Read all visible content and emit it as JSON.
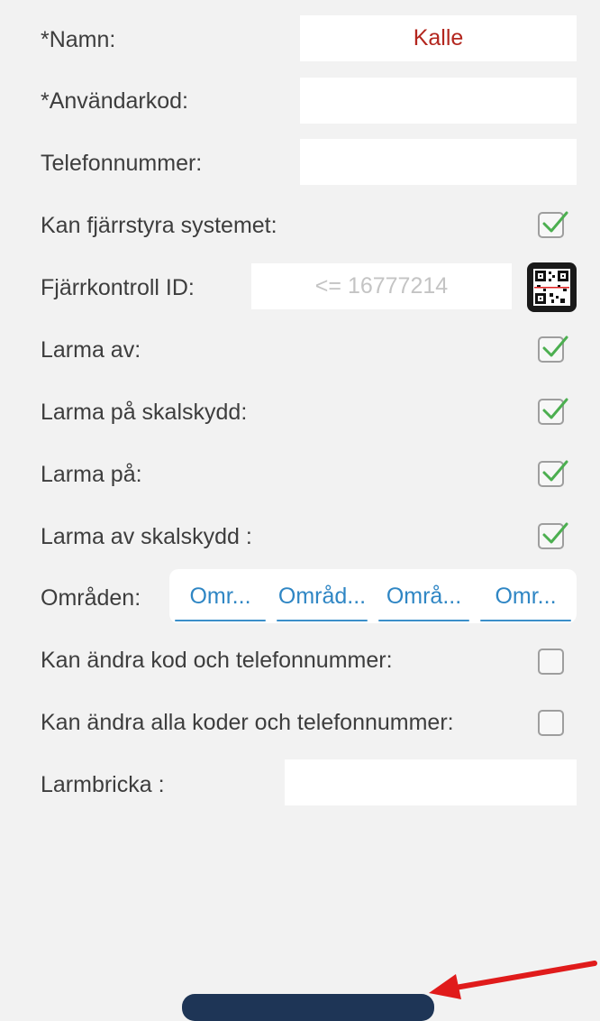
{
  "form": {
    "name_label": "*Namn:",
    "name_value": "Kalle",
    "usercode_label": "*Användarkod:",
    "usercode_value": "",
    "phone_label": "Telefonnummer:",
    "phone_value": "",
    "remote_control_label": "Kan fjärrstyra systemet:",
    "remote_control_checked": true,
    "remote_id_label": "Fjärrkontroll ID:",
    "remote_id_placeholder": "<= 16777214",
    "disarm_label": "Larma av:",
    "disarm_checked": true,
    "arm_perimeter_label": "Larma på skalskydd:",
    "arm_perimeter_checked": true,
    "arm_label": "Larma på:",
    "arm_checked": true,
    "disarm_perimeter_label": "Larma av skalskydd :",
    "disarm_perimeter_checked": true,
    "areas_label": "Områden:",
    "areas": [
      "Omr...",
      "Områd...",
      "Områ...",
      "Omr..."
    ],
    "change_own_label": "Kan ändra kod och telefonnummer:",
    "change_own_checked": false,
    "change_all_label": "Kan ändra alla koder och telefonnummer:",
    "change_all_checked": false,
    "tag_label": "Larmbricka :",
    "tag_value": ""
  },
  "icons": {
    "qr": "qr-code-icon",
    "checkmark": "checkmark-icon",
    "annotation_arrow": "red-arrow"
  },
  "colors": {
    "name_value": "#b3261e",
    "check_green": "#4caf50",
    "area_blue": "#2f86c4",
    "button_dark": "#1e3556",
    "arrow_red": "#e01b1b"
  }
}
